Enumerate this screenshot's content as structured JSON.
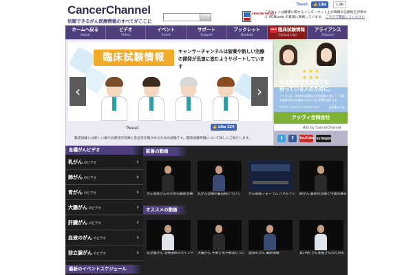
{
  "header": {
    "logo_name": "CancerChannel",
    "logo_tagline": "信頼できるがん医療情報のすべてがここに",
    "hon_verify": "VERIFIED 06/2017",
    "hon_text": "このサイトは健康に関するインターネット上の情報の信頼性を評価する HONcode の基準に準拠しています。",
    "hon_link": "こちらで確認してください",
    "tweet": "Tweet",
    "like_label": "Like",
    "like_count": "1.9K"
  },
  "nav": [
    {
      "jp": "ホームへ戻る",
      "en": "Home"
    },
    {
      "jp": "ビデオ",
      "en": "Video"
    },
    {
      "jp": "イベント",
      "en": "Event"
    },
    {
      "jp": "サポート",
      "en": "Support"
    },
    {
      "jp": "ブックレット",
      "en": "Booklet"
    },
    {
      "jp": "臨床試験情報",
      "en": "Clinical trial",
      "tag": "NEW"
    },
    {
      "jp": "アライアンス",
      "en": "Alliance"
    }
  ],
  "slider": {
    "banner": "臨床試験情報",
    "caption": "キャンサーチャンネルは新薬や新しい治療の開発が迅速に進むようサポートしています",
    "tweet": "Tweet",
    "like_label": "Like",
    "like_count": "224",
    "description": "臨床試験とは新しい薬や治療法の効果と安全性を確かめるための試験です。臨床試験情報について詳しくご紹介します。",
    "prev": "‹",
    "next": "›"
  },
  "ad": {
    "headline_1": "私たちができる全てを、",
    "headline_2": "待っている人のために。",
    "small_text": "アッヴィは、革新的な医薬品の研究開発を通じて、深刻な疾患を抱える患者さんの人生に希望を届けます。",
    "tagline": "PEOPLE. PASSION. POSSIBILITIES.",
    "brand": "abbvie",
    "sponsor": "アッヴィ合同会社",
    "ads_by": "Ads by CancerChannel"
  },
  "social": {
    "twitter": "t",
    "facebook": "f",
    "youtube": "YouTube",
    "ustream": "USTREAM"
  },
  "categories": {
    "heading": "各種がんビデオ",
    "items": [
      {
        "label": "乳がん",
        "sub": "のビデオ"
      },
      {
        "label": "肺がん",
        "sub": "のビデオ"
      },
      {
        "label": "胃がん",
        "sub": "のビデオ"
      },
      {
        "label": "大腸がん",
        "sub": "のビデオ"
      },
      {
        "label": "肝臓がん",
        "sub": "のビデオ"
      },
      {
        "label": "血液のがん",
        "sub": "のビデオ"
      },
      {
        "label": "前立腺がん",
        "sub": "のビデオ"
      },
      {
        "label": "その他のがん",
        "sub": "のビデオ"
      }
    ],
    "schedule_heading": "最新のイベントスケジュール"
  },
  "videos": {
    "new_heading": "新着の動画",
    "featured_heading": "オススメの動画",
    "new": [
      {
        "title": "がん患者さんのための最新治療セミナー"
      },
      {
        "title": "乳がん治療の最前線について"
      },
      {
        "title": "がん医療フォーラム パネルディスカッション"
      },
      {
        "title": "肺がん 最新の治療と今後の展望"
      }
    ],
    "featured": [
      {
        "title": "前立腺がん 治療選択のポイント"
      },
      {
        "title": "大腸がん 手術と化学療法について"
      },
      {
        "title": "血液のがん 最新情報"
      },
      {
        "title": "第14回 がん患者さんのための\"よくわかる治療\"講座"
      }
    ]
  },
  "colors": {
    "nav_bg": "#4f3f7d",
    "ad_bg": "#9cc0e6",
    "sponsor_bg": "#7fb234",
    "banner_bg": "#f1ab2a",
    "dark_bg": "#1d1d1d"
  }
}
